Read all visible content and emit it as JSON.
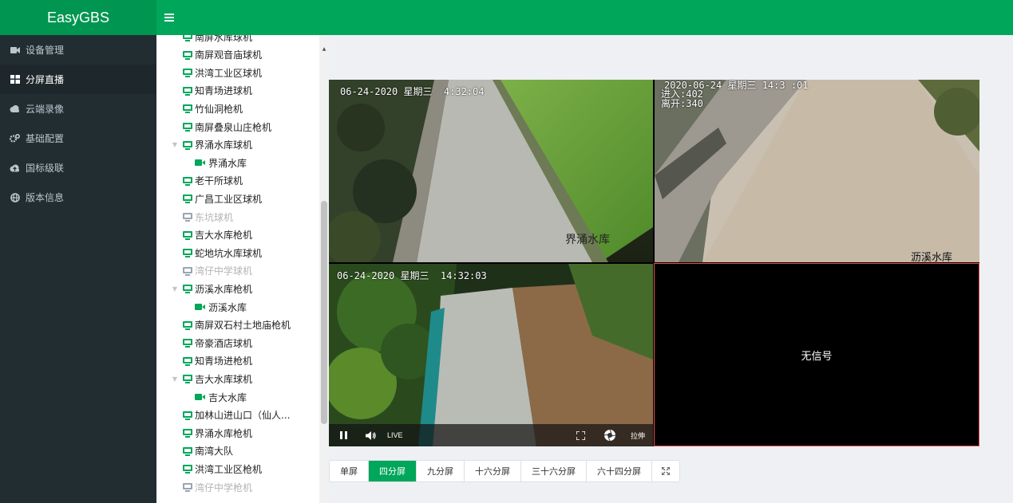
{
  "app": {
    "brand": "EasyGBS",
    "menu_icon": "hamburger-icon"
  },
  "sidebar": {
    "items": [
      {
        "label": "设备管理",
        "icon": "video-camera-icon",
        "active": false
      },
      {
        "label": "分屏直播",
        "icon": "grid-icon",
        "active": true
      },
      {
        "label": "云端录像",
        "icon": "cloud-icon",
        "active": false
      },
      {
        "label": "基础配置",
        "icon": "gears-icon",
        "active": false
      },
      {
        "label": "国标级联",
        "icon": "cloud-upload-icon",
        "active": false
      },
      {
        "label": "版本信息",
        "icon": "globe-icon",
        "active": false
      }
    ]
  },
  "tree": {
    "nodes": [
      {
        "label": "南屏水库球机",
        "type": "device",
        "online": true,
        "expandable": false
      },
      {
        "label": "南屏观音庙球机",
        "type": "device",
        "online": true,
        "expandable": false
      },
      {
        "label": "洪湾工业区球机",
        "type": "device",
        "online": true,
        "expandable": false
      },
      {
        "label": "知青场进球机",
        "type": "device",
        "online": true,
        "expandable": false
      },
      {
        "label": "竹仙洞枪机",
        "type": "device",
        "online": true,
        "expandable": false
      },
      {
        "label": "南屏叠泉山庄枪机",
        "type": "device",
        "online": true,
        "expandable": false
      },
      {
        "label": "界涌水库球机",
        "type": "device",
        "online": true,
        "expandable": true
      },
      {
        "label": "界涌水库",
        "type": "channel",
        "online": true,
        "expandable": false
      },
      {
        "label": "老干所球机",
        "type": "device",
        "online": true,
        "expandable": false
      },
      {
        "label": "广昌工业区球机",
        "type": "device",
        "online": true,
        "expandable": false
      },
      {
        "label": "东坑球机",
        "type": "device",
        "online": false,
        "expandable": false
      },
      {
        "label": "吉大水库枪机",
        "type": "device",
        "online": true,
        "expandable": false
      },
      {
        "label": "蛇地坑水库球机",
        "type": "device",
        "online": true,
        "expandable": false
      },
      {
        "label": "湾仔中学球机",
        "type": "device",
        "online": false,
        "expandable": false
      },
      {
        "label": "沥溪水库枪机",
        "type": "device",
        "online": true,
        "expandable": true
      },
      {
        "label": "沥溪水库",
        "type": "channel",
        "online": true,
        "expandable": false
      },
      {
        "label": "南屏双石村土地庙枪机",
        "type": "device",
        "online": true,
        "expandable": false
      },
      {
        "label": "帝豪酒店球机",
        "type": "device",
        "online": true,
        "expandable": false
      },
      {
        "label": "知青场进枪机",
        "type": "device",
        "online": true,
        "expandable": false
      },
      {
        "label": "吉大水库球机",
        "type": "device",
        "online": true,
        "expandable": true
      },
      {
        "label": "吉大水库",
        "type": "channel",
        "online": true,
        "expandable": false
      },
      {
        "label": "加林山进山口（仙人...",
        "type": "device",
        "online": true,
        "expandable": false
      },
      {
        "label": "界涌水库枪机",
        "type": "device",
        "online": true,
        "expandable": false
      },
      {
        "label": "南湾大队",
        "type": "device",
        "online": true,
        "expandable": false
      },
      {
        "label": "洪湾工业区枪机",
        "type": "device",
        "online": true,
        "expandable": false
      },
      {
        "label": "湾仔中学枪机",
        "type": "device",
        "online": false,
        "expandable": false
      }
    ]
  },
  "players": [
    {
      "osd_time": "06-24-2020 星期三  4:32:04",
      "caption": "界涌水库",
      "status": "playing"
    },
    {
      "osd_time": "2020-06-24 星期三 14:3 :01",
      "osd_lines": [
        "进入:402",
        "离开:340"
      ],
      "caption": "沥溪水库",
      "status": "playing"
    },
    {
      "osd_time": "06-24-2020 星期三  14:32:03",
      "caption": "",
      "status": "playing",
      "controls": {
        "pause_icon": "pause-icon",
        "volume_icon": "volume-icon",
        "live_label": "LIVE",
        "fullscreen_icon": "fullscreen-icon",
        "snapshot_icon": "snapshot-icon",
        "stretch_label": "拉伸"
      }
    },
    {
      "no_signal_label": "无信号",
      "status": "no-signal",
      "selected": true
    }
  ],
  "layout_tabs": [
    {
      "label": "单屏",
      "active": false
    },
    {
      "label": "四分屏",
      "active": true
    },
    {
      "label": "九分屏",
      "active": false
    },
    {
      "label": "十六分屏",
      "active": false
    },
    {
      "label": "三十六分屏",
      "active": false
    },
    {
      "label": "六十四分屏",
      "active": false
    },
    {
      "label": "",
      "icon": "expand-icon",
      "active": false
    }
  ],
  "colors": {
    "primary": "#00a65a",
    "brand_bg": "#009551",
    "sidebar_bg": "#222d32",
    "sidebar_active": "#1e282c",
    "selected_border": "#e64c4c",
    "offline": "#b3b3b3"
  }
}
